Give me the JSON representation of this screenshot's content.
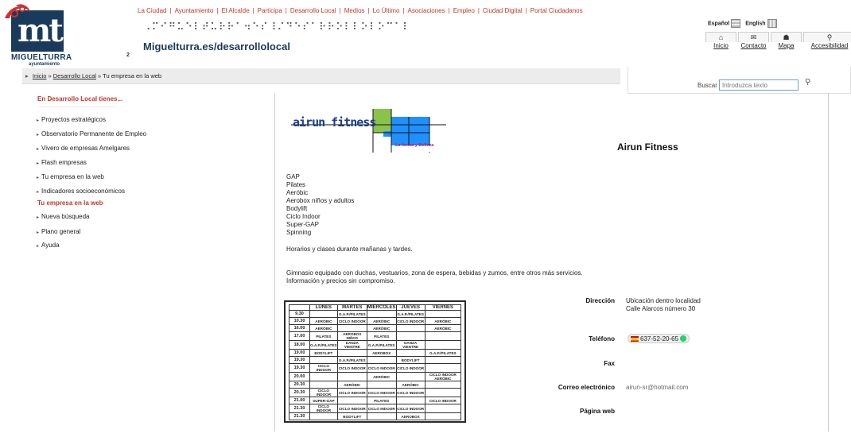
{
  "header": {
    "logo_name": "MIGUELTURRA",
    "logo_sub": "ayuntamiento",
    "logo_mark": "mt",
    "small_mark": "2",
    "braille": "⠠⠍⠊⠛⠥⠑⠇⠞⠥⠗⠗⠁⠲⠑⠎⠸⠌⠙⠑⠎⠁⠗⠗⠕⠇⠇⠕⠇⠕⠉⠁⠇",
    "site_url": "Miguelturra.es/desarrollolocal",
    "nav": [
      "La Ciudad",
      "Ayuntamiento",
      "El Alcalde",
      "Participa",
      "Desarrollo Local",
      "Medios",
      "Lo Último",
      "Asociaciones",
      "Empleo",
      "Ciudad Digital",
      "Portal Ciudadanos"
    ],
    "languages": [
      "Español",
      "English"
    ],
    "quick_links": [
      {
        "label": "Inicio",
        "icon": "home-icon",
        "glyph": "⌂"
      },
      {
        "label": "Contacto",
        "icon": "mail-icon",
        "glyph": "✉"
      },
      {
        "label": "Mapa",
        "icon": "sitemap-icon",
        "glyph": "☗"
      },
      {
        "label": "Accesibilidad",
        "icon": "accessibility-icon",
        "glyph": "⚲"
      }
    ]
  },
  "breadcrumb": {
    "items": [
      "Inicio",
      "Desarrollo Local",
      "Tu empresa en la web"
    ],
    "separator": "»"
  },
  "search": {
    "label": "Buscar",
    "placeholder": "Introduzca texto"
  },
  "sidebar": {
    "heading": "En Desarrollo Local tienes...",
    "items": [
      "Proyectos estratégicos",
      "Observatorio Permanente de Empleo",
      "Vivero de empresas Amelgares",
      "Flash empresas",
      "Tu empresa en la web",
      "Indicadores socioeconómicos"
    ],
    "section_heading": "Tu empresa en la web",
    "section_items": [
      "Nueva búsqueda",
      "Plano general",
      "Ayuda"
    ]
  },
  "business": {
    "name": "Airun Fitness",
    "logo_text": "airun fitness",
    "logo_tagline": "La forma y Belleza",
    "activities": [
      "GAP",
      "Pilates",
      "Aeróbic",
      "Aerobox niños y adultos",
      "Bodylift",
      "Ciclo Indoor",
      "Super-GAP",
      "Spinning"
    ],
    "schedule_note": "Horarios y clases durante mañanas y tardes.",
    "facilities_note": "Gimnasio equipado con duchas, vestuarios, zona de espera, bebidas y zumos, entre otros más servicios.",
    "info_note": "Información y precios sin compromiso.",
    "details": {
      "address_label": "Dirección",
      "address_line1": "Ubicación dentro localidad",
      "address_line2": "Calle Alarcos número 30",
      "phone_label": "Teléfono",
      "phone": "637-52-20-65",
      "fax_label": "Fax",
      "email_label": "Correo electrónico",
      "email": "airun-sr@hotmail.com",
      "web_label": "Página web"
    }
  },
  "timetable": {
    "days": [
      "LUNES",
      "MARTES",
      "MIÉRCOLES",
      "JUEVES",
      "VIERNES"
    ],
    "rows": [
      [
        "9.30",
        "",
        "G.A.P./PILATES",
        "",
        "G.A.P./PILATES",
        ""
      ],
      [
        "10.30",
        "AERÓBIC",
        "CICLO INDOOR",
        "AERÓBIC",
        "CICLO INDOOR",
        "AERÓBIC"
      ],
      [
        "16.00",
        "AERÓBIC",
        "",
        "AERÓBIC",
        "",
        "AERÓBIC"
      ],
      [
        "17.00",
        "PILATES",
        "AEROBOX NIÑOS",
        "PILATES",
        "",
        ""
      ],
      [
        "18.00",
        "G.A.P./PILATES",
        "DANZA VIENTRE",
        "G.A.P./PILATES",
        "DANZA VIENTRE",
        ""
      ],
      [
        "19.00",
        "BODYLIFT",
        "",
        "AEROBOX",
        "",
        "G.A.P./PILATES"
      ],
      [
        "19.30",
        "",
        "G.A.P./PILATES",
        "",
        "BODYLIFT",
        ""
      ],
      [
        "19.30",
        "CICLO INDOOR",
        "CICLO INDOOR",
        "CICLO INDOOR",
        "CICLO INDOOR",
        ""
      ],
      [
        "20.00",
        "",
        "",
        "AERÓBIC",
        "",
        "CICLO INDOOR AERÓBIC"
      ],
      [
        "20.30",
        "",
        "AERÓBIC",
        "",
        "AERÓBIC",
        ""
      ],
      [
        "20.30",
        "CICLO INDOOR",
        "CICLO INDOOR",
        "CICLO INDOOR",
        "CICLO INDOOR",
        ""
      ],
      [
        "21.00",
        "SUPER-GAP",
        "",
        "PILATES",
        "",
        "CICLO INDOOR"
      ],
      [
        "21.30",
        "CICLO INDOOR",
        "CICLO INDOOR",
        "CICLO INDOOR",
        "CICLO INDOOR",
        ""
      ],
      [
        "21.30",
        "",
        "BODYLIFT",
        "",
        "AEROBOX",
        ""
      ]
    ]
  },
  "colors": {
    "accent_red": "#c0392b",
    "brand_navy": "#1a3a5c",
    "logo_green": "#8bc34a",
    "logo_blue": "#1e90ff",
    "logo_magenta": "#c2185b"
  }
}
